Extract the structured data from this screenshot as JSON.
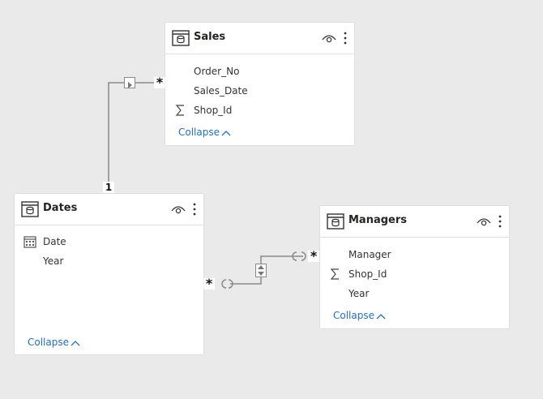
{
  "tables": {
    "sales": {
      "title": "Sales",
      "fields": [
        {
          "label": "Order_No",
          "icon": "none"
        },
        {
          "label": "Sales_Date",
          "icon": "none"
        },
        {
          "label": "Shop_Id",
          "icon": "sum-icon"
        }
      ],
      "collapse_label": "Collapse"
    },
    "dates": {
      "title": "Dates",
      "fields": [
        {
          "label": "Date",
          "icon": "calendar-icon"
        },
        {
          "label": "Year",
          "icon": "none"
        }
      ],
      "collapse_label": "Collapse"
    },
    "managers": {
      "title": "Managers",
      "fields": [
        {
          "label": "Manager",
          "icon": "none"
        },
        {
          "label": "Shop_Id",
          "icon": "sum-icon"
        },
        {
          "label": "Year",
          "icon": "none"
        }
      ],
      "collapse_label": "Collapse"
    }
  },
  "relationships": {
    "sales_dates": {
      "from_end": "*",
      "to_end": "1"
    },
    "dates_managers": {
      "from_end": "*",
      "to_end": "*"
    }
  },
  "colors": {
    "background": "#eaeaea",
    "link": "#1f6fc5",
    "line": "#8a8a8a"
  }
}
